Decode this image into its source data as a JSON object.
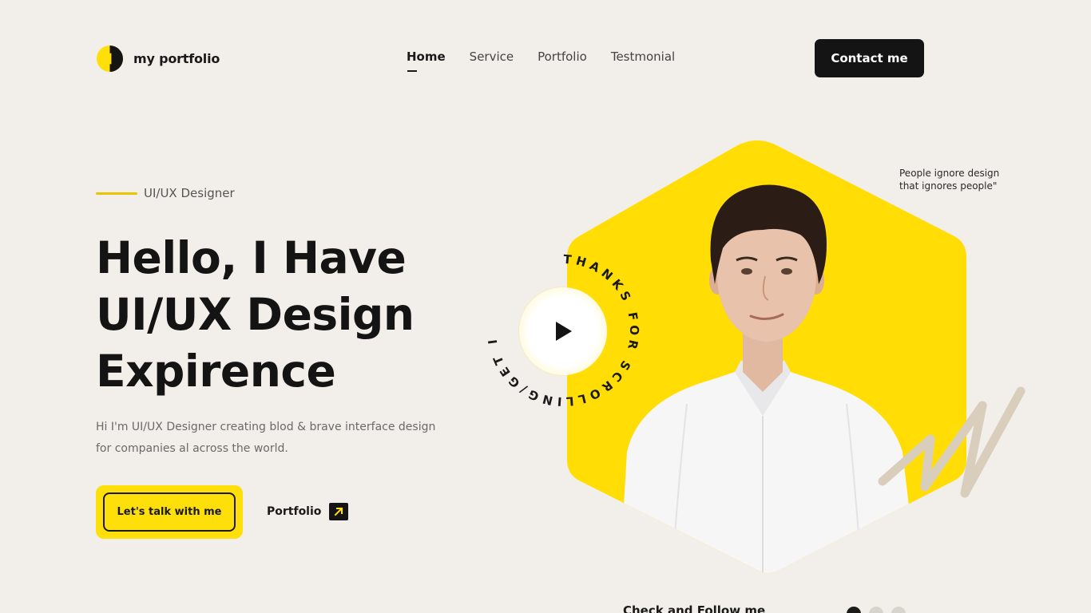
{
  "header": {
    "logo_text": "my portfolio",
    "nav": [
      {
        "label": "Home",
        "active": true
      },
      {
        "label": "Service",
        "active": false
      },
      {
        "label": "Portfolio",
        "active": false
      },
      {
        "label": "Testmonial",
        "active": false
      }
    ],
    "contact_label": "Contact me"
  },
  "hero": {
    "eyebrow": "UI/UX Designer",
    "headline_lines": [
      "Hello, I Have",
      "UI/UX Design",
      "Expirence"
    ],
    "description": "Hi I'm UI/UX Designer creating blod & brave interface design for companies al across the world.",
    "cta_label": "Let's talk with me",
    "portfolio_label": "Portfolio",
    "quote": "People ignore design that ignores people\"",
    "badge_text": "THANKS FOR SCROLLING/GET IN TOUCH*",
    "follow_label": "Check and Follow me"
  },
  "colors": {
    "background": "#f2eeea",
    "accent": "#ffdf09",
    "dark": "#141414"
  },
  "icons": {
    "logo": "half-circle-logo-icon",
    "play": "play-icon",
    "arrow": "arrow-up-right-icon"
  }
}
